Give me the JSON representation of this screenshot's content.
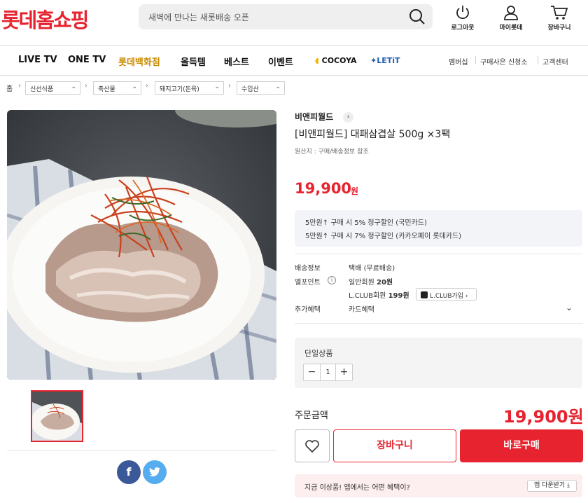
{
  "header": {
    "logo": "롯데홈쇼핑",
    "search_placeholder": "새벽에 만나는 새롯배송 오픈",
    "logout_label": "로그아웃",
    "mypage_label": "마이롯데",
    "cart_label": "장바구니"
  },
  "nav": {
    "items": [
      "LIVE TV",
      "ONE TV",
      "롯데백화점",
      "올득템",
      "베스트",
      "이벤트",
      "COCOYA",
      "LETiT"
    ],
    "right": [
      "멤버십",
      "구매사은 신청소",
      "고객센터"
    ],
    "highlight_color": "#c98a00"
  },
  "breadcrumb": {
    "home": "홈",
    "levels": [
      "신선식품",
      "축산물",
      "돼지고기(돈육)",
      "수입산"
    ]
  },
  "product": {
    "brand": "비앤피월드",
    "title": "[비앤피월드] 대패삼겹살 500g ×3팩",
    "origin": "원산지 : 구매/배송정보 참조",
    "price": "19,900",
    "price_unit": "원",
    "promos": [
      "5만원↑ 구매 시 5% 청구할인 (국민카드)",
      "5만원↑ 구매 시 7% 청구할인 (카카오페이 롯데카드)"
    ]
  },
  "info": {
    "shipping_label": "배송정보",
    "shipping_value": "택배 (무료배송)",
    "point_label": "엘포인트",
    "point_general_prefix": "일반회원",
    "point_general_value": "20원",
    "point_lclub_prefix": "L.CLUB회원",
    "point_lclub_value": "199원",
    "lclub_join": "L.CLUB가입",
    "benefit_label": "추가혜택",
    "benefit_value": "카드혜택"
  },
  "option": {
    "label": "단일상품",
    "quantity": "1"
  },
  "order": {
    "label": "주문금액",
    "total": "19,900원",
    "cart_button": "장바구니",
    "buy_button": "바로구매"
  },
  "app_bar": {
    "text": "지금 이상품! 앱에서는 어떤 혜택이?",
    "button": "앱 다운받기 ⤓"
  },
  "colors": {
    "brand_red": "#e6232f"
  }
}
